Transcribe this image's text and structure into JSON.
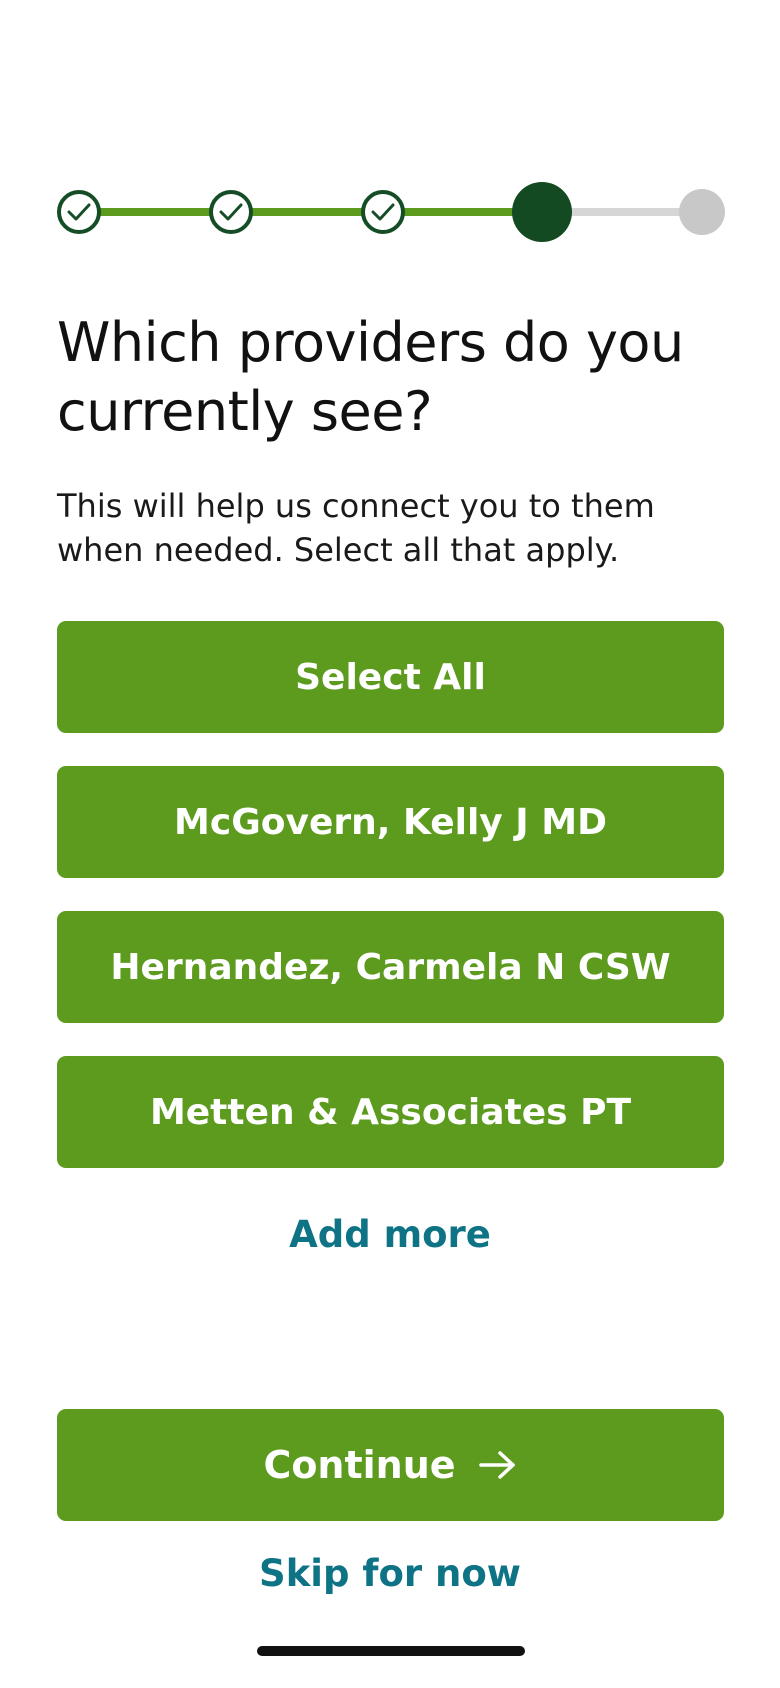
{
  "progress": {
    "steps": [
      {
        "state": "completed",
        "icon": "check-icon"
      },
      {
        "state": "completed",
        "icon": "check-icon"
      },
      {
        "state": "completed",
        "icon": "check-icon"
      },
      {
        "state": "current"
      },
      {
        "state": "upcoming"
      }
    ],
    "current_step": 4,
    "total_steps": 5
  },
  "header": {
    "title": "Which providers do you currently see?",
    "subtitle": "This will help us connect you to them when needed. Select all that apply."
  },
  "options": {
    "select_all_label": "Select All",
    "providers": [
      "McGovern, Kelly J MD",
      "Hernandez, Carmela N CSW",
      "Metten & Associates PT"
    ]
  },
  "actions": {
    "add_more_label": "Add more",
    "continue_label": "Continue",
    "continue_icon": "arrow-right-icon",
    "skip_label": "Skip for now"
  },
  "colors": {
    "primary_green": "#5c9b1e",
    "dark_green": "#134a22",
    "link_teal": "#0f7386",
    "inactive_gray": "#c8c8c8"
  }
}
